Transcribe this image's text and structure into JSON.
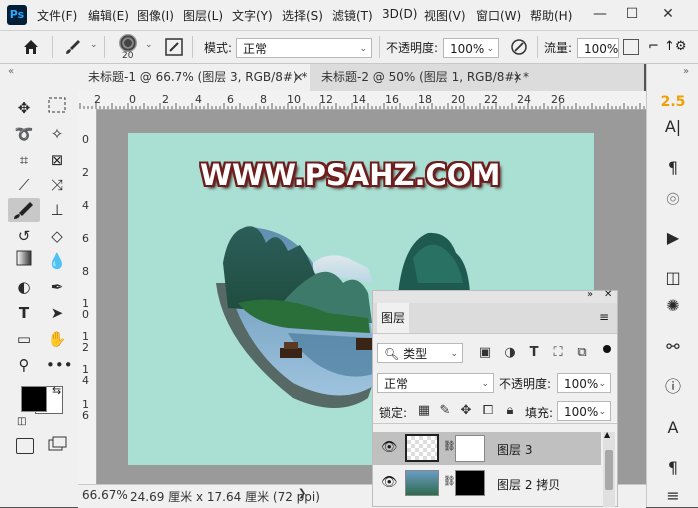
{
  "app": {
    "logo": "Ps"
  },
  "menu": [
    "文件(F)",
    "编辑(E)",
    "图像(I)",
    "图层(L)",
    "文字(Y)",
    "选择(S)",
    "滤镜(T)",
    "3D(D)",
    "视图(V)",
    "窗口(W)",
    "帮助(H)"
  ],
  "window_controls": {
    "minimize": "—",
    "maximize": "☐",
    "close": "✕"
  },
  "options": {
    "brush_size": "20",
    "mode_label": "模式:",
    "mode_value": "正常",
    "opacity_label": "不透明度:",
    "opacity_value": "100%",
    "flow_label": "流量:",
    "flow_value": "100%"
  },
  "tabs": [
    {
      "label": "未标题-1 @ 66.7% (图层 3, RGB/8#) *",
      "close": "✕",
      "active": true
    },
    {
      "label": "未标题-2 @ 50% (图层 1, RGB/8#) *",
      "close": "✕",
      "active": false
    }
  ],
  "ruler": {
    "h": [
      "2",
      "0",
      "2",
      "4",
      "6",
      "8",
      "10",
      "12",
      "14",
      "16",
      "18",
      "20",
      "22",
      "24",
      "26"
    ],
    "v": [
      "0",
      "2",
      "4",
      "6",
      "8",
      "1\n0",
      "1\n2",
      "1\n4",
      "1\n6"
    ]
  },
  "canvas": {
    "watermark": "WWW.PSAHZ.COM",
    "background": "#a9e0d3"
  },
  "status": {
    "zoom": "66.67%",
    "doc_size": "24.69 厘米 x 17.64 厘米 (72 ppi)",
    "arrow": "❯"
  },
  "right_panel": {
    "char_size": "2.5"
  },
  "layers_panel": {
    "title": "图层",
    "filter_kind": "类型",
    "blend_mode": "正常",
    "opacity_label": "不透明度:",
    "opacity_value": "100%",
    "lock_label": "锁定:",
    "fill_label": "填充:",
    "fill_value": "100%",
    "layers": [
      {
        "name": "图层 3",
        "selected": true
      },
      {
        "name": "图层 2 拷贝",
        "selected": false
      }
    ]
  },
  "colors": {
    "accent": "#f0a000",
    "selection": "#c0c0c0"
  }
}
